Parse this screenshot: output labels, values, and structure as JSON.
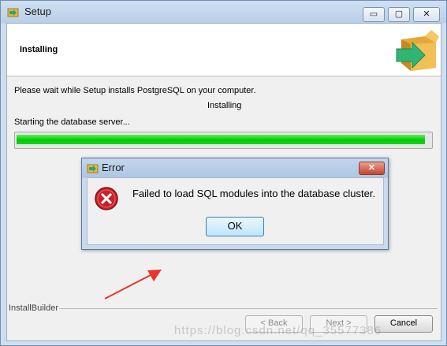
{
  "window": {
    "title": "Setup",
    "minimize_glyph": "▭",
    "maximize_glyph": "▢",
    "close_glyph": "✕"
  },
  "header": {
    "title": "Installing"
  },
  "content": {
    "status_text": "Please wait while Setup installs PostgreSQL on your computer.",
    "installing_label": "Installing",
    "step_text": "Starting the database server...",
    "progress": 0.99
  },
  "footer": {
    "brand_label": "InstallBuilder",
    "back_label": "< Back",
    "next_label": "Next >",
    "cancel_label": "Cancel"
  },
  "watermark": "https://blog.csdn.net/qq_35577386",
  "error_dialog": {
    "title": "Error",
    "close_glyph": "✕",
    "message": "Failed to load SQL modules into the database cluster.",
    "ok_label": "OK"
  },
  "colors": {
    "progress_green": "#06c806",
    "error_red": "#c8202a",
    "annotation_arrow": "#e8352a"
  }
}
